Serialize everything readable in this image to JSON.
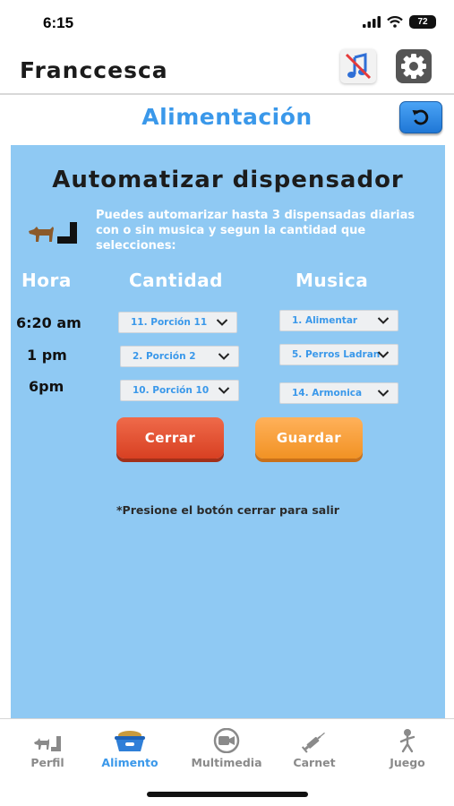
{
  "status": {
    "time": "6:15",
    "battery": "72"
  },
  "header": {
    "user_name": "Franccesca"
  },
  "section": {
    "title": "Alimentación"
  },
  "panel": {
    "title": "Automatizar dispensador",
    "description": "Puedes automarizar hasta 3 dispensadas diarias con o sin musica y segun la cantidad que selecciones:",
    "columns": {
      "hora": "Hora",
      "cantidad": "Cantidad",
      "musica": "Musica"
    },
    "rows": [
      {
        "time": "6:20 am",
        "cantidad": "11. Porción 11",
        "musica": "1. Alimentar"
      },
      {
        "time": "1 pm",
        "cantidad": "2. Porción 2",
        "musica": "5. Perros Ladran"
      },
      {
        "time": "6pm",
        "cantidad": "10. Porción 10",
        "musica": "14. Armonica"
      }
    ],
    "close_label": "Cerrar",
    "save_label": "Guardar",
    "note": "*Presione el botón cerrar para salir"
  },
  "nav": {
    "items": [
      {
        "label": "Perfil",
        "icon": "dog-bowl-profile-icon"
      },
      {
        "label": "Alimento",
        "icon": "food-bowl-icon"
      },
      {
        "label": "Multimedia",
        "icon": "video-camera-icon"
      },
      {
        "label": "Carnet",
        "icon": "syringe-icon"
      },
      {
        "label": "Juego",
        "icon": "running-figure-icon"
      }
    ],
    "active_color": "#3a98ea",
    "inactive_color": "#8a8a8a"
  },
  "colors": {
    "accent": "#3a98ea",
    "panel": "#8fc9f3",
    "close": "#e2502e",
    "save": "#f6a03a"
  }
}
